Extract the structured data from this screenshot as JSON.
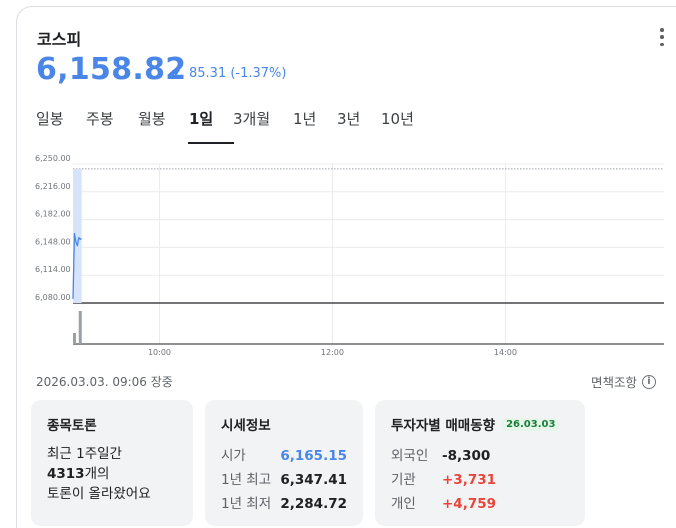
{
  "header": {
    "title": "코스피",
    "price": "6,158.82",
    "change": "85.31 (-1.37%)"
  },
  "tabs": [
    "일봉",
    "주봉",
    "월봉",
    "1일",
    "3개월",
    "1년",
    "3년",
    "10년"
  ],
  "active_tab": "1일",
  "chart_data": {
    "type": "line",
    "y_tick_labels": [
      "6,250.00",
      "6,216.00",
      "6,182.00",
      "6,148.00",
      "6,114.00",
      "6,080.00"
    ],
    "x_tick_labels": [
      "10:00",
      "12:00",
      "14:00"
    ],
    "ylim": [
      6080,
      6250
    ],
    "line_color": "#4a86e8",
    "reference_line_value": 6244,
    "series": [
      {
        "x": [
          "09:00",
          "09:01",
          "09:02",
          "09:03",
          "09:04",
          "09:05",
          "09:06"
        ],
        "values": [
          6085,
          6165,
          6155,
          6150,
          6160,
          6158,
          6158.82
        ]
      }
    ],
    "volume": [
      {
        "x": "09:00",
        "value": 11
      },
      {
        "x": "09:04",
        "value": 33
      }
    ]
  },
  "status": {
    "datetime": "2026.03.03. 09:06 장중",
    "disclaimer": "면책조항",
    "info_icon": "i"
  },
  "discussion": {
    "title": "종목토론",
    "line1": "최근 1주일간",
    "count": "4313",
    "count_suffix": "개의",
    "line3": "토론이 올라왔어요"
  },
  "market_info": {
    "title": "시세정보",
    "rows": [
      {
        "label": "시가",
        "value": "6,165.15"
      },
      {
        "label": "1년 최고",
        "value": "6,347.41"
      },
      {
        "label": "1년 최저",
        "value": "2,284.72"
      }
    ]
  },
  "investors": {
    "title": "투자자별 매매동향",
    "date": "26.03.03",
    "rows": [
      {
        "label": "외국인",
        "value": "-8,300"
      },
      {
        "label": "기관",
        "value": "+3,731"
      },
      {
        "label": "개인",
        "value": "+4,759"
      }
    ]
  }
}
